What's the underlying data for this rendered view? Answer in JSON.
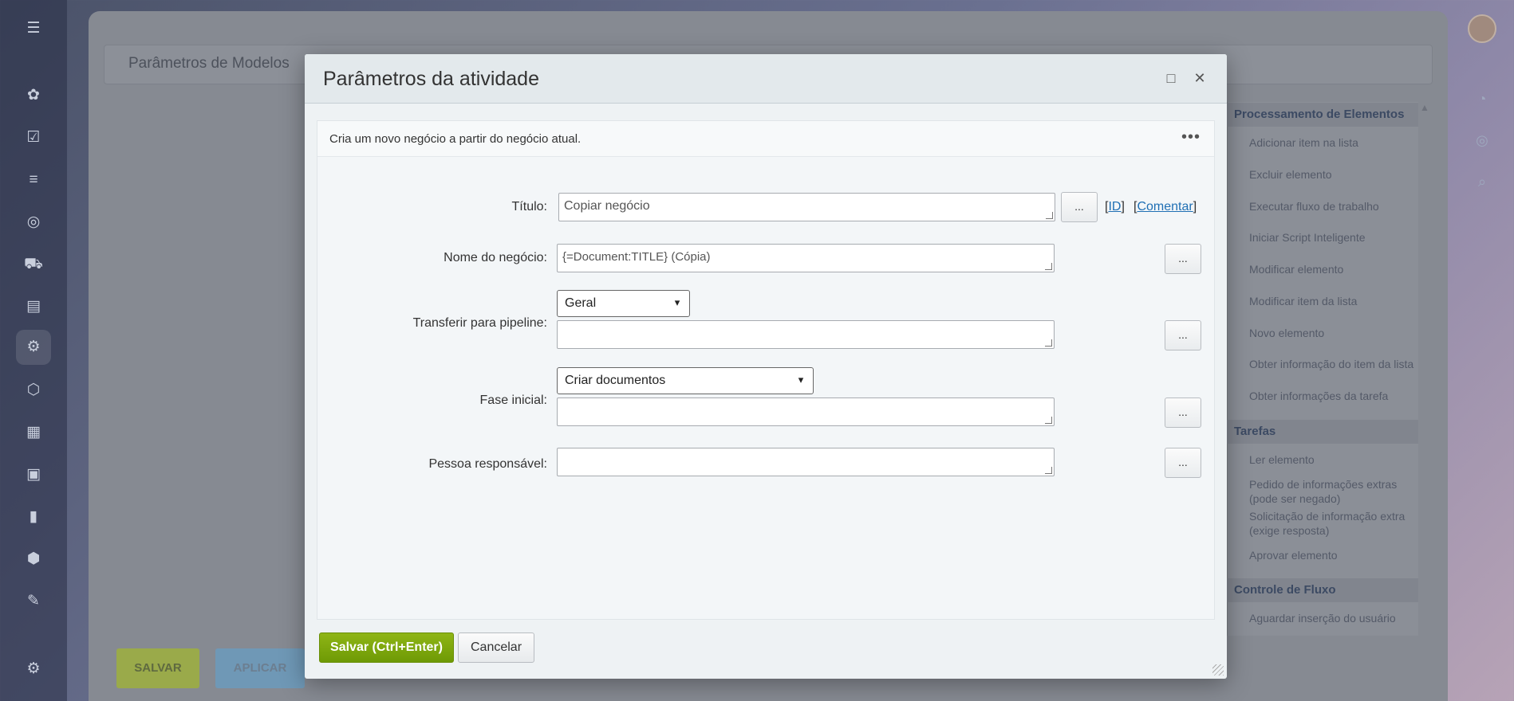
{
  "background": {
    "page_title": "Parâmetros de Modelos",
    "save_button": "SALVAR",
    "apply_button": "APLICAR",
    "toolbox": {
      "groups": [
        {
          "title": "Processamento de Elementos",
          "items": [
            "Adicionar item na lista",
            "Excluir elemento",
            "Executar fluxo de trabalho",
            "Iniciar Script Inteligente",
            "Modificar elemento",
            "Modificar item da lista",
            "Novo elemento",
            "Obter informação do item da lista",
            "Obter informações da tarefa"
          ]
        },
        {
          "title": "Tarefas",
          "items": [
            "Ler elemento",
            "Pedido de informações extras (pode ser negado)",
            "Solicitação de informação extra (exige resposta)",
            "Aprovar elemento"
          ]
        },
        {
          "title": "Controle de Fluxo",
          "items": [
            "Aguardar inserção do usuário"
          ]
        }
      ]
    }
  },
  "modal": {
    "title": "Parâmetros da atividade",
    "description": "Cria um novo negócio a partir do negócio atual.",
    "more_icon": "more-horizontal-icon",
    "maximize_icon": "maximize-icon",
    "close_icon": "close-icon",
    "fields": {
      "title": {
        "label": "Título:",
        "value": "Copiar negócio",
        "id_link": "ID",
        "comment_link": "Comentar"
      },
      "deal_name": {
        "label": "Nome do negócio:",
        "value": "{=Document:TITLE} (Cópia)"
      },
      "pipeline": {
        "label": "Transferir para pipeline:",
        "selected": "Geral",
        "value": ""
      },
      "initial_stage": {
        "label": "Fase inicial:",
        "selected": "Criar documentos",
        "value": ""
      },
      "responsible": {
        "label": "Pessoa responsável:",
        "value": ""
      }
    },
    "dots_label": "...",
    "save_button": "Salvar (Ctrl+Enter)",
    "cancel_button": "Cancelar"
  }
}
